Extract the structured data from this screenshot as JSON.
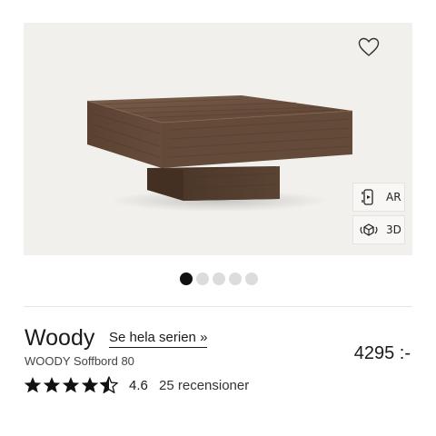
{
  "product": {
    "name": "Woody",
    "series_link": "Se hela serien »",
    "subtitle": "WOODY Soffbord 80",
    "price": "4295 :-",
    "rating": {
      "value": "4.6",
      "stars": 4.6,
      "max": 5,
      "reviews": "25 recensioner"
    }
  },
  "gallery": {
    "count": 5,
    "active": 1
  },
  "view_buttons": [
    {
      "label": "AR",
      "icon": "ar-icon"
    },
    {
      "label": "3D",
      "icon": "3d-cube-icon"
    }
  ],
  "icons": {
    "favorite": "heart-outline-icon",
    "star": "star-icon"
  },
  "colors": {
    "accent": "#1a1a1a",
    "image_bg": "#f2f0ed",
    "wood": "#6e5443"
  }
}
